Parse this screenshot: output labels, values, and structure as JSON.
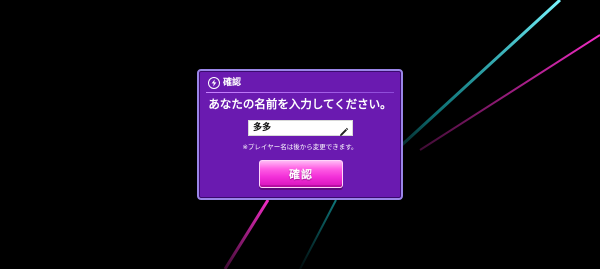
{
  "dialog": {
    "title": "確認",
    "message": "あなたの名前を入力してください。",
    "name_value": "多多",
    "note": "※プレイヤー名は後から変更できます。",
    "confirm_label": "確認"
  },
  "icons": {
    "header": "lightning-bolt-icon",
    "field": "pencil-icon"
  },
  "colors": {
    "background": "#000000",
    "dialog_fill": "#6a1ab0",
    "dialog_border": "#9a85e8",
    "button_pink": "#f22fd8",
    "streak_magenta": "#ff2fd0",
    "streak_cyan": "#1ad8e0"
  }
}
